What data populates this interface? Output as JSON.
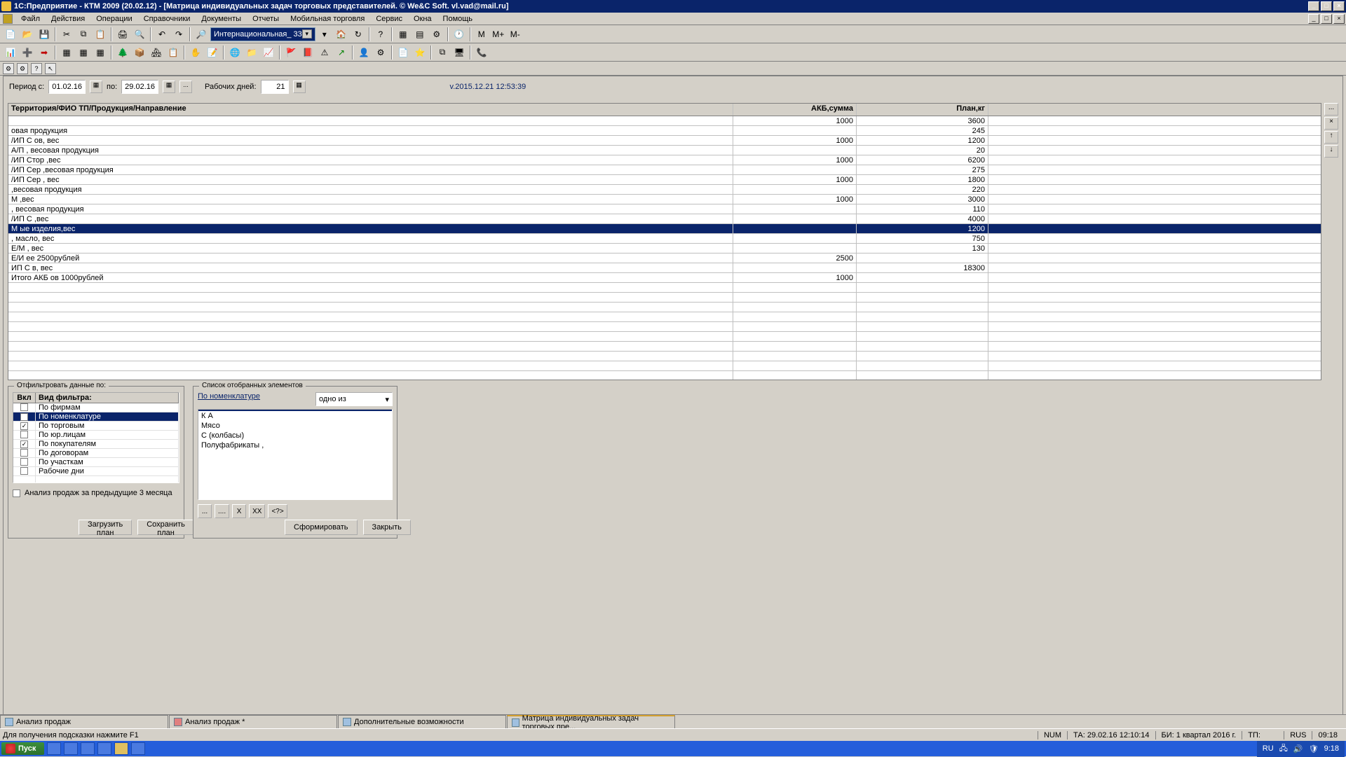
{
  "titlebar": "1С:Предприятие - КТМ 2009 (20.02.12) - [Матрица индивидуальных задач торговых представителей. © We&C Soft. vl.vad@mail.ru]",
  "menu": [
    "Файл",
    "Действия",
    "Операции",
    "Справочники",
    "Документы",
    "Отчеты",
    "Мобильная торговля",
    "Сервис",
    "Окна",
    "Помощь"
  ],
  "toolbar_combo": "Интернациональная_ 33",
  "period": {
    "from_label": "Период с:",
    "from": "01.02.16",
    "to_label": "по:",
    "to": "29.02.16",
    "workdays_label": "Рабочих дней:",
    "workdays": "21",
    "version": "v.2015.12.21 12:53:39"
  },
  "grid": {
    "headers": [
      "Территория/ФИО ТП/Продукция/Направление",
      "АКБ,сумма",
      "План,кг"
    ],
    "rows": [
      {
        "c1": "",
        "c2": "1000",
        "c3": "3600"
      },
      {
        "c1": "                                               овая продукция",
        "c2": "",
        "c3": "245"
      },
      {
        "c1": "                                          /ИП С           ов, вес",
        "c2": "1000",
        "c3": "1200"
      },
      {
        "c1": "            А/П                                      , весовая продукция",
        "c2": "",
        "c3": "20"
      },
      {
        "c1": "                          /ИП Стор            ,вес",
        "c2": "1000",
        "c3": "6200"
      },
      {
        "c1": "                                 /ИП Сер         ,весовая продукция",
        "c2": "",
        "c3": "275"
      },
      {
        "c1": "                          /ИП Сер            , вес",
        "c2": "1000",
        "c3": "1800"
      },
      {
        "c1": "                                              ,весовая продукция",
        "c2": "",
        "c3": "220"
      },
      {
        "c1": "  М                                                   ,вес",
        "c2": "1000",
        "c3": "3000"
      },
      {
        "c1": "                                                  , весовая продукция",
        "c2": "",
        "c3": "110"
      },
      {
        "c1": "                                /ИП С              ,вес",
        "c2": "",
        "c3": "4000"
      },
      {
        "c1": "  М                                              ые изделия,вес",
        "c2": "",
        "c3": "1200",
        "sel": true
      },
      {
        "c1": "                                                  , масло, вес",
        "c2": "",
        "c3": "750"
      },
      {
        "c1": "                         Е/М                    , вес",
        "c2": "",
        "c3": "130"
      },
      {
        "c1": "                  Е/И                   ее 2500рублей",
        "c2": "2500",
        "c3": ""
      },
      {
        "c1": "                ИП С              в, вес",
        "c2": "",
        "c3": "18300"
      },
      {
        "c1": "Итого АКБ             ов 1000рублей",
        "c2": "1000",
        "c3": ""
      }
    ]
  },
  "filter_left": {
    "title": "Отфильтровать данные по:",
    "headers": [
      "Вкл",
      "Вид фильтра:"
    ],
    "rows": [
      {
        "on": false,
        "name": "По фирмам"
      },
      {
        "on": true,
        "name": "По номенклатуре",
        "sel": true
      },
      {
        "on": true,
        "name": "По торговым"
      },
      {
        "on": false,
        "name": "По юр.лицам"
      },
      {
        "on": true,
        "name": "По покупателям"
      },
      {
        "on": false,
        "name": "По договорам"
      },
      {
        "on": false,
        "name": "По участкам"
      },
      {
        "on": false,
        "name": "Рабочие дни"
      }
    ],
    "analysis_check": "Анализ продаж за предыдущие 3 месяца"
  },
  "filter_right": {
    "title": "Список отобранных элементов",
    "by_label": "По номенклатуре",
    "mode": "одно из",
    "items": [
      {
        "name": "                          ",
        "sel": true
      },
      {
        "name": "К           А"
      },
      {
        "name": "Мясо"
      },
      {
        "name": "С                 (колбасы)"
      },
      {
        "name": "Полуфабрикаты            ,"
      }
    ],
    "btns": [
      "...",
      "....",
      "X",
      "XX",
      "<?>"
    ]
  },
  "buttons": {
    "load_plan": "Загрузить план",
    "save_plan": "Сохранить план",
    "form": "Сформировать",
    "close": "Закрыть"
  },
  "doctabs": [
    {
      "label": "Анализ продаж",
      "active": false
    },
    {
      "label": "Анализ продаж *",
      "active": false,
      "red": true
    },
    {
      "label": "Дополнительные возможности",
      "active": false
    },
    {
      "label": "Матрица индивидуальных задач торговых пре...",
      "active": true
    }
  ],
  "statusbar": {
    "hint": "Для получения подсказки нажмите F1",
    "num": "NUM",
    "ta": "ТА: 29.02.16  12:10:14",
    "bi": "БИ: 1 квартал 2016 г.",
    "tp": "ТП:",
    "lang": "RUS",
    "time": "09:18"
  },
  "taskbar": {
    "start": "Пуск",
    "lang": "RU",
    "clock": "9:18"
  }
}
